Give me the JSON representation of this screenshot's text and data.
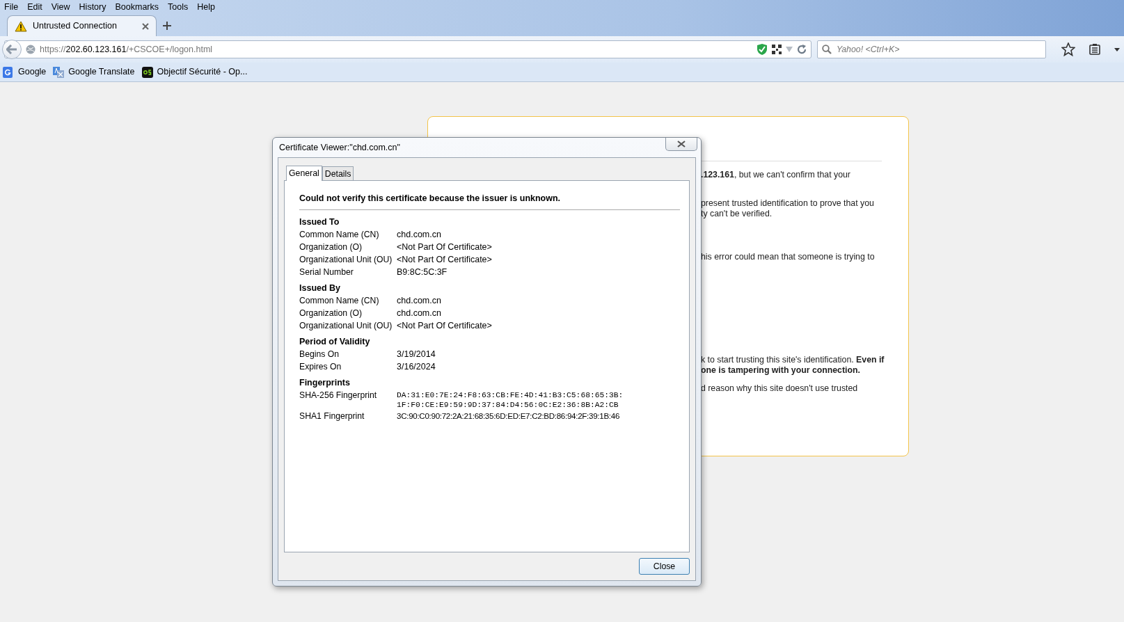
{
  "menu": [
    "File",
    "Edit",
    "View",
    "History",
    "Bookmarks",
    "Tools",
    "Help"
  ],
  "tabs": [
    {
      "label": "Untrusted Connection",
      "selected": true
    }
  ],
  "address_bar": {
    "scheme": "https://",
    "host": "202.60.123.161",
    "path": "/+CSCOE+/logon.html"
  },
  "search": {
    "placeholder": "Yahoo! <Ctrl+K>"
  },
  "bookmarks": [
    {
      "label": "Google"
    },
    {
      "label": "Google Translate"
    },
    {
      "label": "Objectif Sécurité - Op..."
    }
  ],
  "background_page": {
    "paragraphs": [
      {
        "lines": [
          "**.123.161**, but we can't confirm that your"
        ]
      },
      {
        "lines": [
          "present trusted identification to prove that you",
          "ty can't be verified."
        ]
      },
      {
        "lines": [
          "his error could mean that someone is trying to"
        ]
      },
      {
        "lines": [
          "k to start trusting this site's identification. **Even if**",
          "**one is tampering with your connection.**"
        ]
      },
      {
        "lines": [
          "d reason why this site doesn't use trusted"
        ]
      }
    ]
  },
  "dialog": {
    "title": "Certificate Viewer:\"chd.com.cn\"",
    "tabs": [
      {
        "label": "General",
        "selected": true
      },
      {
        "label": "Details",
        "selected": false
      }
    ],
    "heading": "Could not verify this certificate because the issuer is unknown.",
    "sections": [
      {
        "title": "Issued To",
        "rows": [
          {
            "label": "Common Name (CN)",
            "value": "chd.com.cn"
          },
          {
            "label": "Organization (O)",
            "value": "<Not Part Of Certificate>"
          },
          {
            "label": "Organizational Unit (OU)",
            "value": "<Not Part Of Certificate>"
          },
          {
            "label": "Serial Number",
            "value": "B9:8C:5C:3F"
          }
        ]
      },
      {
        "title": "Issued By",
        "rows": [
          {
            "label": "Common Name (CN)",
            "value": "chd.com.cn"
          },
          {
            "label": "Organization (O)",
            "value": "chd.com.cn"
          },
          {
            "label": "Organizational Unit (OU)",
            "value": "<Not Part Of Certificate>"
          }
        ]
      },
      {
        "title": "Period of Validity",
        "rows": [
          {
            "label": "Begins On",
            "value": "3/19/2014"
          },
          {
            "label": "Expires On",
            "value": "3/16/2024"
          }
        ]
      },
      {
        "title": "Fingerprints",
        "rows": [
          {
            "label": "SHA-256 Fingerprint",
            "value": "DA:31:E0:7E:24:F8:63:CB:FE:4D:41:B3:C5:68:65:3B:1F:F0:CE:E9:59:9D:37:84:D4:56:0C:E2:36:8B:A2:CB",
            "kind": "mono"
          },
          {
            "label": "SHA1 Fingerprint",
            "value": "3C:90:C0:90:72:2A:21:68:35:6D:ED:E7:C2:BD:86:94:2F:39:1B:46",
            "kind": "narrow"
          }
        ]
      }
    ],
    "close_button": "Close"
  }
}
